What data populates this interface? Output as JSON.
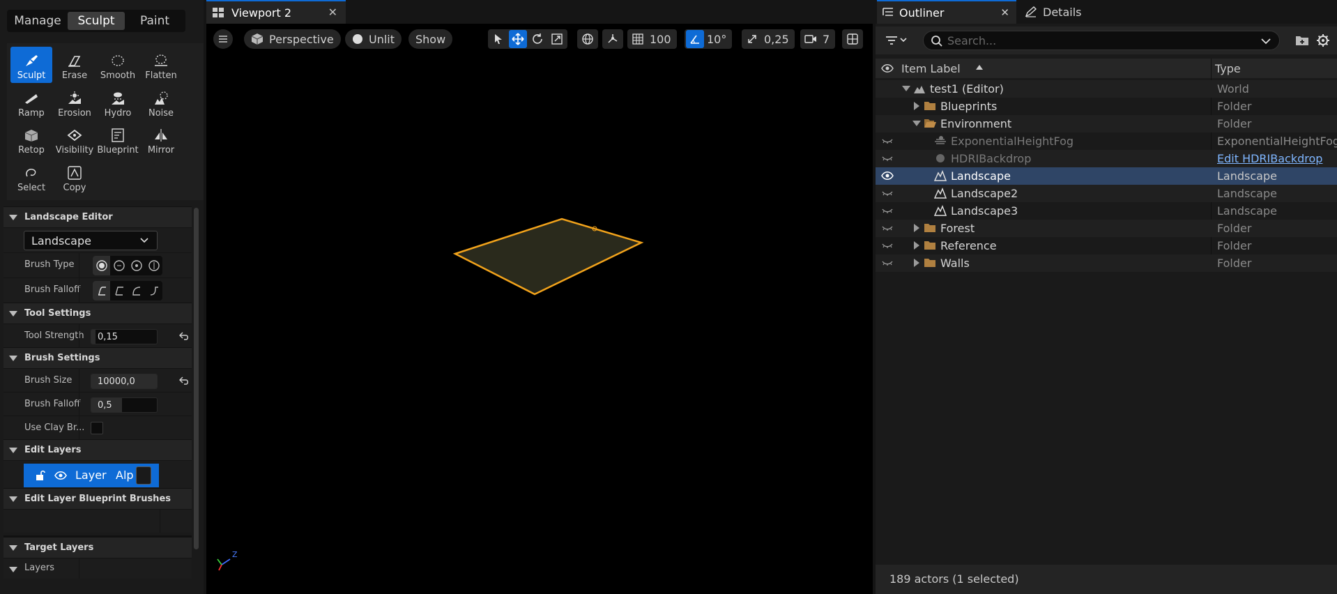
{
  "modes": [
    {
      "label": "Manage",
      "active": false
    },
    {
      "label": "Sculpt",
      "active": true
    },
    {
      "label": "Paint",
      "active": false
    }
  ],
  "tools": [
    {
      "label": "Sculpt",
      "icon": "sculpt-icon",
      "active": true
    },
    {
      "label": "Erase",
      "icon": "erase-icon"
    },
    {
      "label": "Smooth",
      "icon": "smooth-icon"
    },
    {
      "label": "Flatten",
      "icon": "flatten-icon"
    },
    {
      "label": "Ramp",
      "icon": "ramp-icon"
    },
    {
      "label": "Erosion",
      "icon": "erosion-icon"
    },
    {
      "label": "Hydro",
      "icon": "hydro-icon"
    },
    {
      "label": "Noise",
      "icon": "noise-icon"
    },
    {
      "label": "Retop",
      "icon": "retop-icon"
    },
    {
      "label": "Visibility",
      "icon": "visibility-icon"
    },
    {
      "label": "Blueprint",
      "icon": "blueprint-icon"
    },
    {
      "label": "Mirror",
      "icon": "mirror-icon"
    },
    {
      "label": "Select",
      "icon": "select-icon"
    },
    {
      "label": "Copy",
      "icon": "copy-icon"
    }
  ],
  "landscape_editor": {
    "section": "Landscape Editor",
    "selected": "Landscape",
    "brush_type_label": "Brush Type",
    "brush_falloff_label": "Brush Falloff"
  },
  "tool_settings": {
    "section": "Tool Settings",
    "tool_strength_label": "Tool Strength",
    "tool_strength": "0,15"
  },
  "brush_settings": {
    "section": "Brush Settings",
    "brush_size_label": "Brush Size",
    "brush_size": "10000,0",
    "brush_falloff_label": "Brush Falloff",
    "brush_falloff": "0,5",
    "use_clay_label": "Use Clay Br..."
  },
  "edit_layers": {
    "section": "Edit Layers",
    "layer_name": "Layer",
    "layer_alpha": "Alp"
  },
  "edit_layer_bp": {
    "section": "Edit Layer Blueprint Brushes"
  },
  "target_layers": {
    "section": "Target Layers",
    "layers_label": "Layers"
  },
  "viewport": {
    "tab_title": "Viewport 2",
    "perspective": "Perspective",
    "lighting": "Unlit",
    "show": "Show",
    "grid_snap": "100",
    "rotation_snap": "10°",
    "scale_snap": "0,25",
    "camera_speed": "7"
  },
  "outliner": {
    "tab_title": "Outliner",
    "details_tab": "Details",
    "search_placeholder": "Search...",
    "col_label": "Item Label",
    "col_type": "Type",
    "status": "189 actors (1 selected)",
    "rows": [
      {
        "label": "test1 (Editor)",
        "type": "World",
        "depth": 0,
        "expander": "open",
        "icon": "world-icon"
      },
      {
        "label": "Blueprints",
        "type": "Folder",
        "depth": 1,
        "expander": "closed",
        "icon": "folder-icon"
      },
      {
        "label": "Environment",
        "type": "Folder",
        "depth": 1,
        "expander": "open",
        "icon": "folder-open-icon"
      },
      {
        "label": "ExponentialHeightFog",
        "type": "ExponentialHeightFog",
        "depth": 2,
        "icon": "fog-icon",
        "dim": true,
        "eye": "hidden"
      },
      {
        "label": "HDRIBackdrop",
        "type": "Edit HDRIBackdrop",
        "depth": 2,
        "icon": "sphere-icon",
        "dim": true,
        "eye": "hidden",
        "link": true
      },
      {
        "label": "Landscape",
        "type": "Landscape",
        "depth": 2,
        "icon": "landscape-icon",
        "selected": true,
        "eye": "visible"
      },
      {
        "label": "Landscape2",
        "type": "Landscape",
        "depth": 2,
        "icon": "landscape-icon",
        "eye": "hidden"
      },
      {
        "label": "Landscape3",
        "type": "Landscape",
        "depth": 2,
        "icon": "landscape-icon",
        "eye": "hidden"
      },
      {
        "label": "Forest",
        "type": "Folder",
        "depth": 1,
        "expander": "closed",
        "icon": "folder-icon",
        "eye": "hidden"
      },
      {
        "label": "Reference",
        "type": "Folder",
        "depth": 1,
        "expander": "closed",
        "icon": "folder-icon",
        "eye": "hidden"
      },
      {
        "label": "Walls",
        "type": "Folder",
        "depth": 1,
        "expander": "closed",
        "icon": "folder-icon",
        "eye": "hidden"
      }
    ]
  },
  "colors": {
    "accent": "#0e6bd6",
    "selection_outline": "#f2a31b",
    "selected_row": "#2f4566",
    "folder": "#b08040"
  }
}
